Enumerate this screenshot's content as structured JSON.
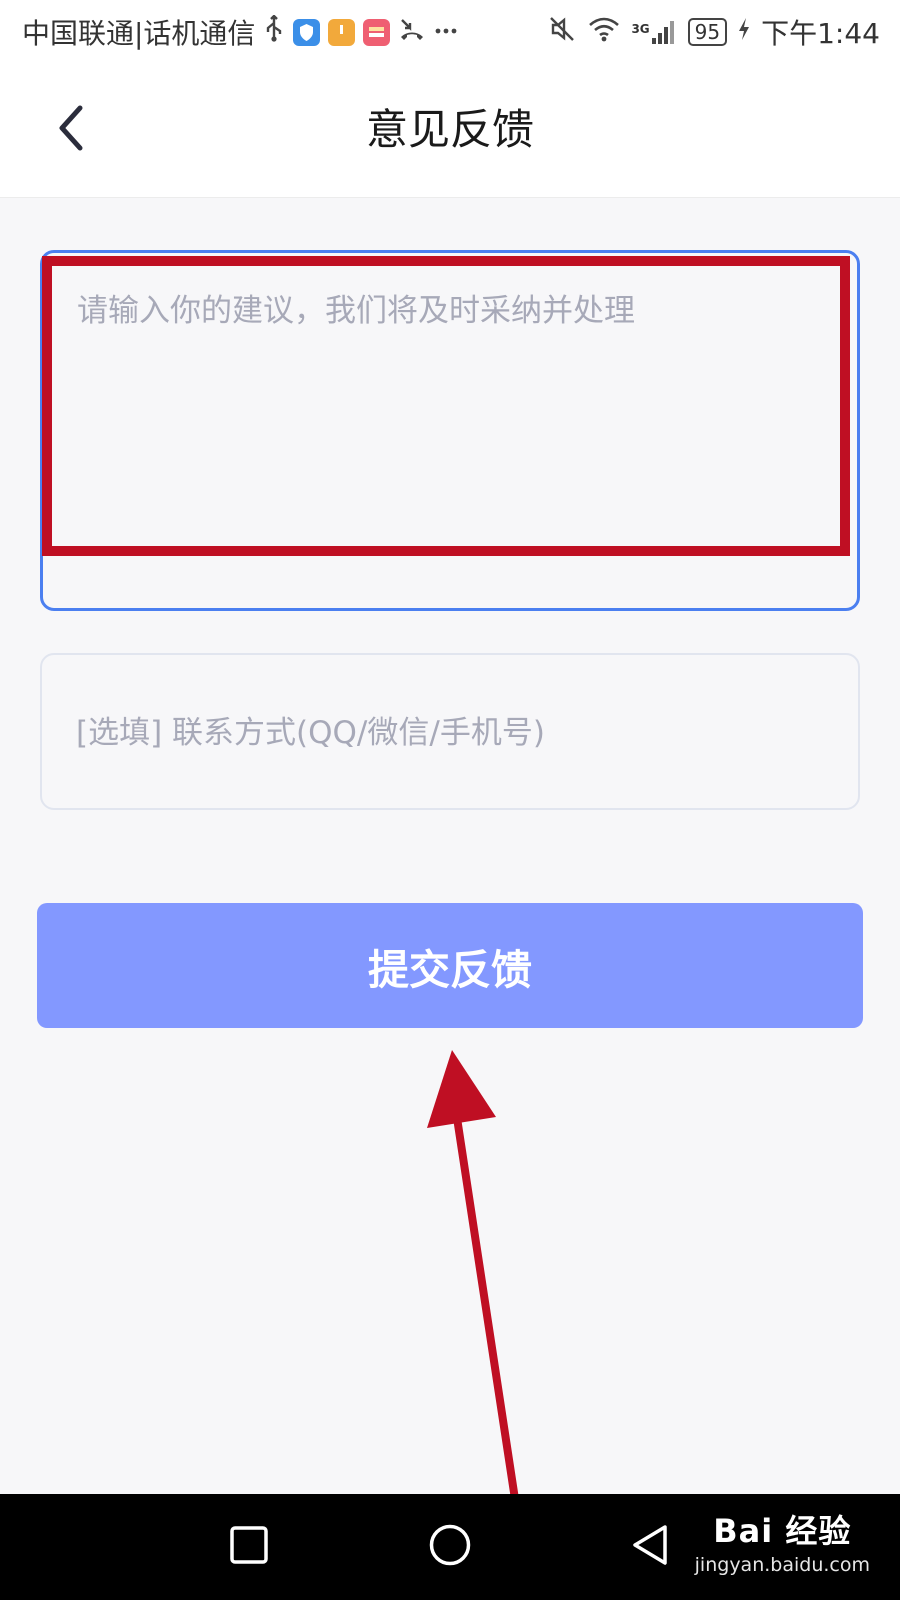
{
  "status_bar": {
    "carrier": "中国联通|话机通信",
    "network": "3G",
    "battery": "95",
    "time": "下午1:44",
    "icons": [
      "usb-icon",
      "shield-app-icon",
      "box-app-icon",
      "wallet-app-icon",
      "missed-call-icon",
      "more-icon",
      "mute-icon",
      "wifi-icon",
      "signal-icon",
      "battery-icon",
      "charging-icon"
    ]
  },
  "header": {
    "title": "意见反馈",
    "back_icon": "chevron-left-icon"
  },
  "form": {
    "feedback_placeholder": "请输入你的建议，我们将及时采纳并处理",
    "contact_placeholder": "[选填] 联系方式(QQ/微信/手机号)",
    "submit_label": "提交反馈"
  },
  "nav_bar": {
    "icons": [
      "recent-apps-icon",
      "home-icon",
      "back-triangle-icon"
    ]
  },
  "watermark": {
    "logo": "Bai 经验",
    "url": "jingyan.baidu.com"
  },
  "colors": {
    "accent": "#4b7ff0",
    "button": "#8398ff",
    "annotation": "#bf0f23",
    "placeholder": "#a7a9b8"
  }
}
